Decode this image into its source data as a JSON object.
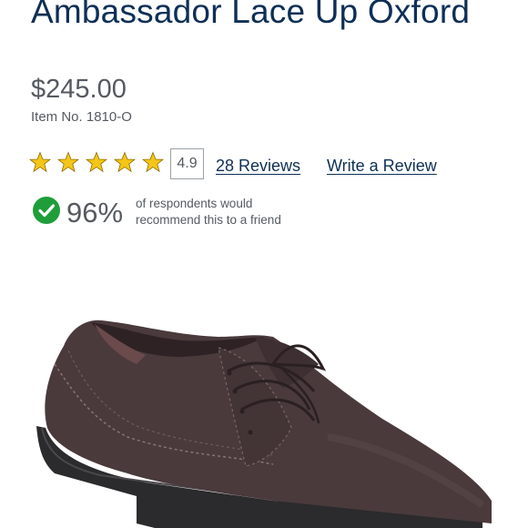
{
  "product": {
    "title": "Ambassador Lace Up Oxford",
    "price": "$245.00",
    "item_no": "Item No. 1810-O"
  },
  "rating": {
    "stars": 5,
    "score": "4.9",
    "reviews_link": "28 Reviews",
    "write_review_link": "Write a Review"
  },
  "recommend": {
    "percent": "96%",
    "text_line1": "of respondents would",
    "text_line2": "recommend this to a friend"
  },
  "colors": {
    "title": "#0e2f56",
    "star": "#f5c518",
    "check": "#1f9d3a",
    "text": "#555a60"
  },
  "image": {
    "icon": "shoe-image"
  }
}
